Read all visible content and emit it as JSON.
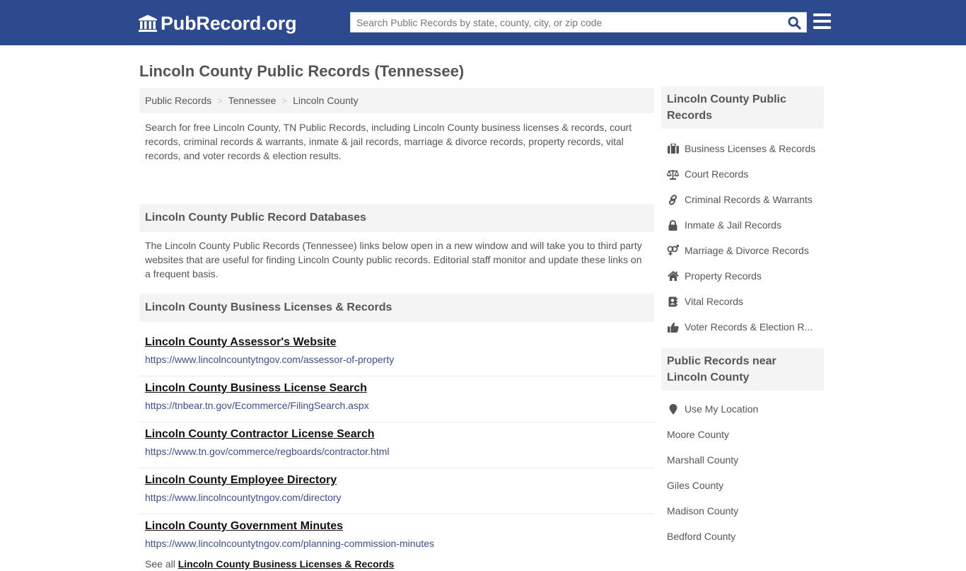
{
  "header": {
    "logo_text": "PubRecord.org",
    "logo_icon": "courthouse-icon",
    "search_placeholder": "Search Public Records by state, county, city, or zip code",
    "search_value": "",
    "search_icon": "search-icon",
    "menu_icon": "hamburger-menu-icon",
    "colors": {
      "bar": "#2e4a8e",
      "search_icon": "#2e4a8e"
    }
  },
  "page": {
    "title": "Lincoln County Public Records (Tennessee)"
  },
  "breadcrumb": [
    {
      "label": "Public Records"
    },
    {
      "label": "Tennessee"
    },
    {
      "label": "Lincoln County"
    }
  ],
  "breadcrumb_separator": ">",
  "intro": "Search for free Lincoln County, TN Public Records, including Lincoln County business licenses & records, court records, criminal records & warrants, inmate & jail records, marriage & divorce records, property records, vital records, and voter records & election results.",
  "databases": {
    "heading": "Lincoln County Public Record Databases",
    "description": "The Lincoln County Public Records (Tennessee) links below open in a new window and will take you to third party websites that are useful for finding Lincoln County public records. Editorial staff monitor and update these links on a frequent basis."
  },
  "business_section": {
    "heading": "Lincoln County Business Licenses & Records",
    "links": [
      {
        "title": "Lincoln County Assessor's Website",
        "url": "https://www.lincolncountytngov.com/assessor-of-property"
      },
      {
        "title": "Lincoln County Business License Search",
        "url": "https://tnbear.tn.gov/Ecommerce/FilingSearch.aspx"
      },
      {
        "title": "Lincoln County Contractor License Search",
        "url": "https://www.tn.gov/commerce/regboards/contractor.html"
      },
      {
        "title": "Lincoln County Employee Directory",
        "url": "https://www.lincolncountytngov.com/directory"
      },
      {
        "title": "Lincoln County Government Minutes",
        "url": "https://www.lincolncountytngov.com/planning-commission-minutes"
      }
    ],
    "see_all_prefix": "See all",
    "see_all_link": "Lincoln County Business Licenses & Records"
  },
  "sidebar": {
    "records_heading": "Lincoln County Public Records",
    "records": [
      {
        "label": "Business Licenses & Records",
        "icon": "briefcase-icon"
      },
      {
        "label": "Court Records",
        "icon": "balance-scale-icon"
      },
      {
        "label": "Criminal Records & Warrants",
        "icon": "link-icon"
      },
      {
        "label": "Inmate & Jail Records",
        "icon": "lock-icon"
      },
      {
        "label": "Marriage & Divorce Records",
        "icon": "venus-mars-icon"
      },
      {
        "label": "Property Records",
        "icon": "home-icon"
      },
      {
        "label": "Vital Records",
        "icon": "address-book-icon"
      },
      {
        "label": "Voter Records & Election R...",
        "icon": "thumbs-up-icon"
      }
    ],
    "near_heading": "Public Records near Lincoln County",
    "use_location": {
      "label": "Use My Location",
      "icon": "map-marker-icon"
    },
    "near": [
      {
        "label": "Moore County"
      },
      {
        "label": "Marshall County"
      },
      {
        "label": "Giles County"
      },
      {
        "label": "Madison County"
      },
      {
        "label": "Bedford County"
      }
    ]
  }
}
